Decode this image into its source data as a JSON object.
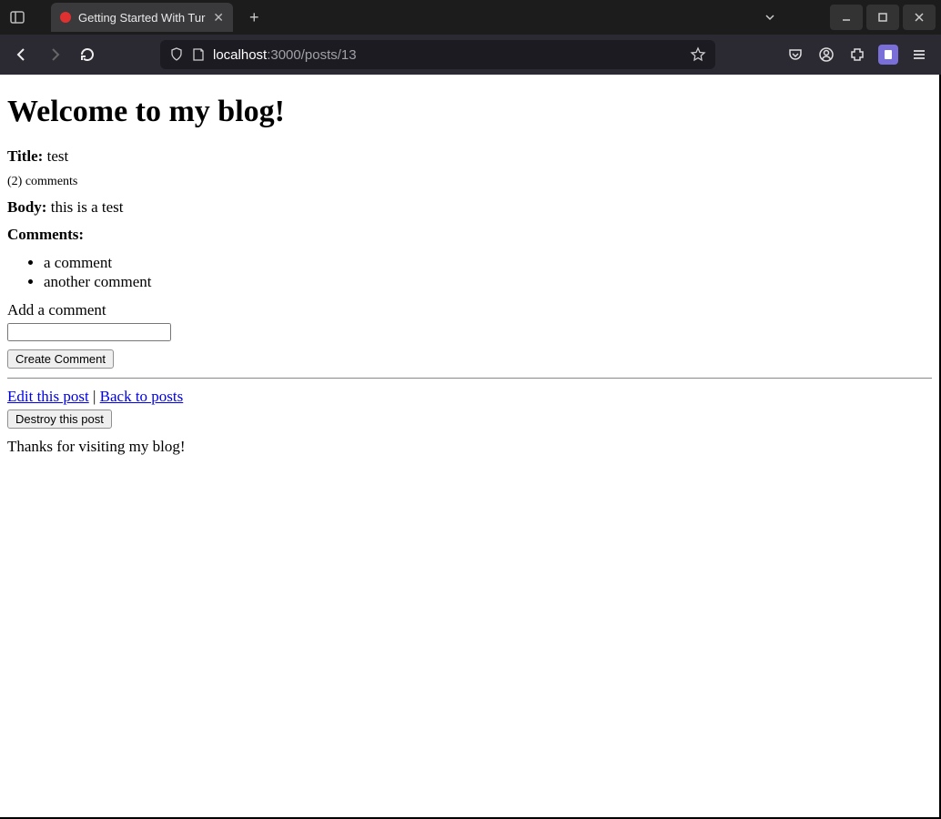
{
  "browser": {
    "tab_title": "Getting Started With Tur",
    "url_host": "localhost",
    "url_path": ":3000/posts/13"
  },
  "page": {
    "heading": "Welcome to my blog!",
    "title_label": "Title:",
    "title_value": "test",
    "comments_count_text": "(2) comments",
    "body_label": "Body:",
    "body_value": "this is a test",
    "comments_label": "Comments:",
    "comments": [
      "a comment",
      "another comment"
    ],
    "add_comment_label": "Add a comment",
    "comment_input_value": "",
    "create_comment_button": "Create Comment",
    "edit_link": "Edit this post",
    "separator": " | ",
    "back_link": "Back to posts",
    "destroy_button": "Destroy this post",
    "footer_text": "Thanks for visiting my blog!"
  }
}
